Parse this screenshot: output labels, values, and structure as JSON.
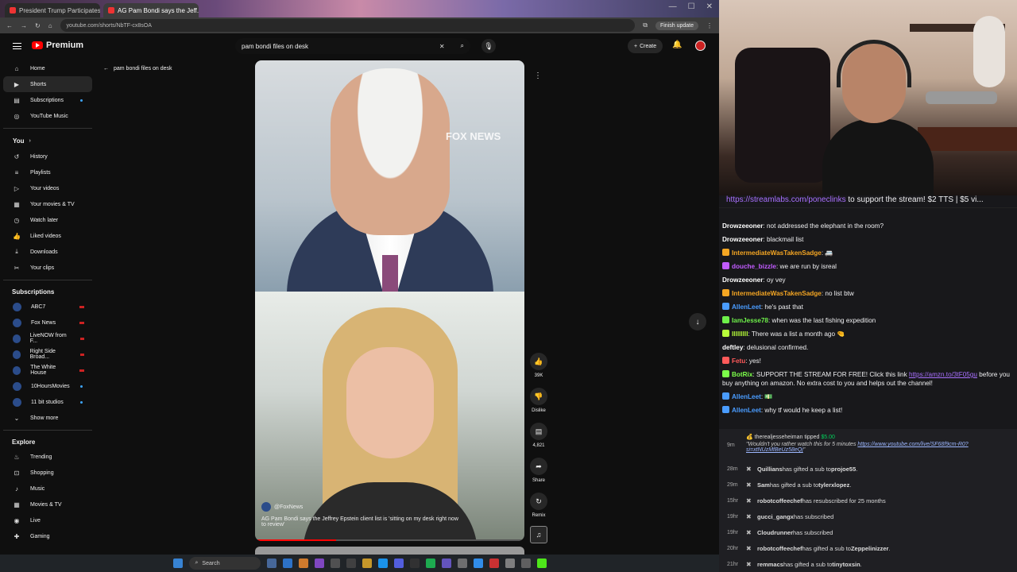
{
  "browser": {
    "tabs": [
      {
        "label": "President Trump Participates in..."
      },
      {
        "label": "AG Pam Bondi says the Jeff..."
      }
    ],
    "url": "youtube.com/shorts/NbTF-cx8sOA",
    "finish_update": "Finish update"
  },
  "header": {
    "logo_text": "Premium",
    "search_value": "pam bondi files on desk",
    "create_label": "Create"
  },
  "sidebar": {
    "main": [
      {
        "icon": "home-icon",
        "label": "Home"
      },
      {
        "icon": "shorts-icon",
        "label": "Shorts"
      },
      {
        "icon": "subscriptions-icon",
        "label": "Subscriptions"
      },
      {
        "icon": "youtube-music-icon",
        "label": "YouTube Music"
      }
    ],
    "you_label": "You",
    "you_items": [
      {
        "label": "History"
      },
      {
        "label": "Playlists"
      },
      {
        "label": "Your videos"
      },
      {
        "label": "Your movies & TV"
      },
      {
        "label": "Watch later"
      },
      {
        "label": "Liked videos"
      },
      {
        "label": "Downloads"
      },
      {
        "label": "Your clips"
      }
    ],
    "subscriptions_label": "Subscriptions",
    "subscriptions": [
      {
        "label": "ABC7"
      },
      {
        "label": "Fox News"
      },
      {
        "label": "LiveNOW from F..."
      },
      {
        "label": "Right Side Broad..."
      },
      {
        "label": "The White House"
      },
      {
        "label": "10HoursMovies"
      },
      {
        "label": "11 bit studios"
      }
    ],
    "show_more": "Show more",
    "explore_label": "Explore",
    "explore": [
      {
        "label": "Trending"
      },
      {
        "label": "Shopping"
      },
      {
        "label": "Music"
      },
      {
        "label": "Movies & TV"
      },
      {
        "label": "Live"
      },
      {
        "label": "Gaming"
      }
    ]
  },
  "shorts": {
    "back_label": "pam bondi files on desk",
    "watermark": "FOX NEWS",
    "channel": "@FoxNews",
    "caption": "AG Pam Bondi says the Jeffrey Epstein client list is 'sitting on my desk right now to review'",
    "likes": "39K",
    "dislike_label": "Dislike",
    "comments": "4,821",
    "share_label": "Share",
    "remix_label": "Remix"
  },
  "taskbar": {
    "search_label": "Search"
  },
  "chat": {
    "pinned_link": "https://streamlabs.com/poneclinks",
    "pinned_text": " to support the stream! $2 TTS | $5 vi...",
    "messages": [
      {
        "user": "Drowzeeoner",
        "color": "#ffffff",
        "text": "not addressed the elephant in the room?"
      },
      {
        "user": "Drowzeeoner",
        "color": "#ffffff",
        "text": "blackmail list"
      },
      {
        "user": "IntermediateWasTakenSadge",
        "color": "#f5a623",
        "text": "🚐"
      },
      {
        "user": "douche_bizzle",
        "color": "#c15cff",
        "text": "we are run by isreal"
      },
      {
        "user": "Drowzeeoner",
        "color": "#ffffff",
        "text": "oy vey"
      },
      {
        "user": "IntermediateWasTakenSadge",
        "color": "#f5a623",
        "text": "no list btw"
      },
      {
        "user": "AllenLeet",
        "color": "#4a9cff",
        "text": "he's past that"
      },
      {
        "user": "IamJesse78",
        "color": "#6ef04a",
        "text": "when was the last fishing expedition"
      },
      {
        "user": "lllllllll",
        "color": "#b8ff3a",
        "text": "There was a list a month ago 🤏"
      },
      {
        "user": "deftley",
        "color": "#ffffff",
        "text": "delusional confirmed."
      },
      {
        "user": "Fetu",
        "color": "#ff5a5a",
        "text": "yes!"
      },
      {
        "user": "BotRix",
        "color": "#7cff4a",
        "text": "SUPPORT THE STREAM FOR FREE! Click this link ",
        "link": "https://amzn.to/3tF05gu",
        "text2": " before you buy anything on amazon. No extra cost to you and helps out the channel!"
      },
      {
        "user": "AllenLeet",
        "color": "#4a9cff",
        "text": "💵"
      },
      {
        "user": "AllenLeet",
        "color": "#4a9cff",
        "text": "why tf would he keep a list!"
      }
    ],
    "tip": {
      "time": "9m",
      "user": "therealjesseheiman",
      "action": " tipped ",
      "amount": "$5.00",
      "message": "\"Wouldn't you rather watch this for 5 minutes ",
      "link": "https://www.youtube.com/live/SF68f9cm-R0?si=xtNUzMfBeUz58eQj",
      "message_end": "\""
    },
    "events": [
      {
        "time": "28m",
        "user": "Quillians",
        "text": " has gifted a sub to ",
        "target": "projoe55",
        "end": "."
      },
      {
        "time": "29m",
        "user": "Sam",
        "text": " has gifted a sub to ",
        "target": "tylerxlopez",
        "end": "."
      },
      {
        "time": "15hr",
        "user": "robotcoffeechef",
        "text": " has resubscribed for 25 months",
        "target": "",
        "end": ""
      },
      {
        "time": "19hr",
        "user": "gucci_gangx",
        "text": " has subscribed",
        "target": "",
        "end": ""
      },
      {
        "time": "19hr",
        "user": "Cloudrunner",
        "text": " has subscribed",
        "target": "",
        "end": ""
      },
      {
        "time": "20hr",
        "user": "robotcoffeechef",
        "text": " has gifted a sub to ",
        "target": "Zeppelinizzer",
        "end": "."
      },
      {
        "time": "21hr",
        "user": "remmacs",
        "text": " has gifted a sub to ",
        "target": "tinytoxsin",
        "end": "."
      }
    ]
  }
}
